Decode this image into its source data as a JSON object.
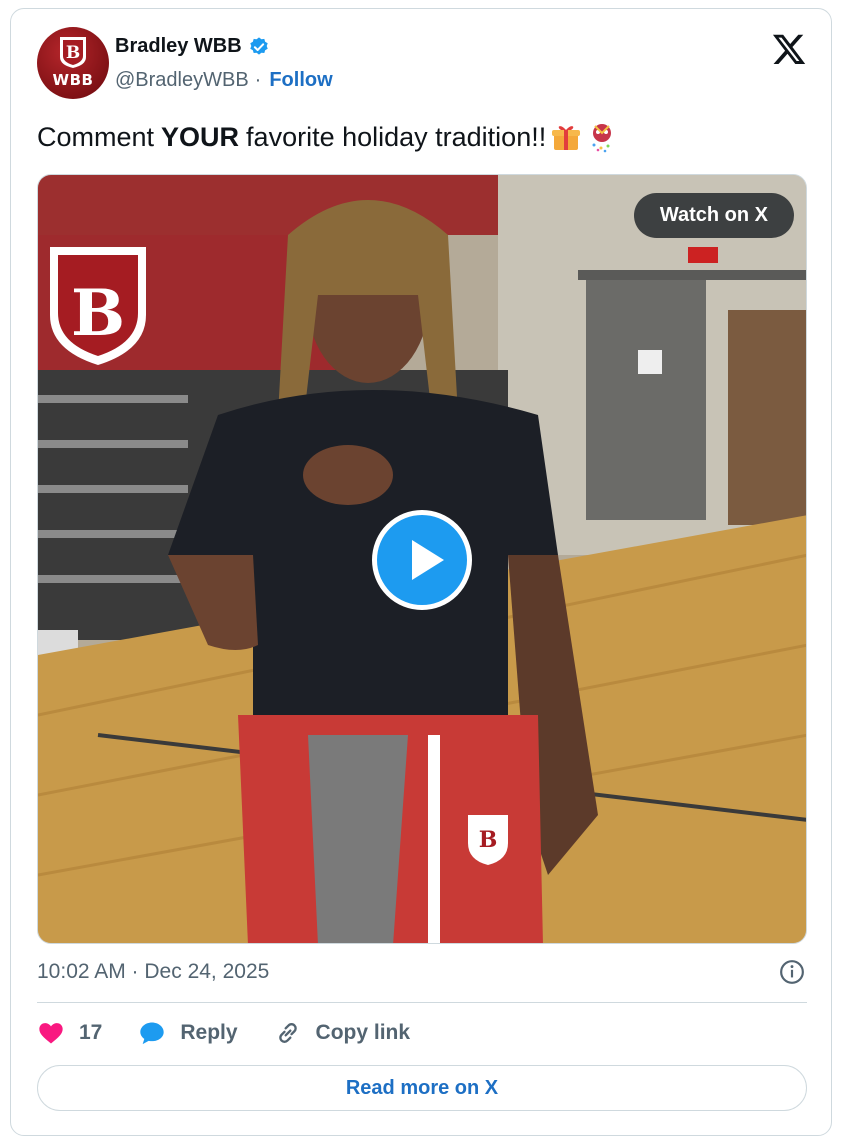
{
  "author": {
    "name": "Bradley WBB",
    "handle": "@BradleyWBB",
    "separator": "·",
    "follow_label": "Follow",
    "avatar_text": "WBB",
    "verified": true
  },
  "tweet": {
    "text_before": "Comment",
    "text_bold": "YOUR",
    "text_after": "favorite holiday tradition!!",
    "emojis": [
      "gift-emoji",
      "party-popper-emoji"
    ]
  },
  "media": {
    "type": "video",
    "watch_label": "Watch on X"
  },
  "meta": {
    "timestamp": "10:02 AM · Dec 24, 2025"
  },
  "actions": {
    "likes_count": "17",
    "reply_label": "Reply",
    "copy_label": "Copy link"
  },
  "footer": {
    "read_more_label": "Read more on X"
  },
  "colors": {
    "accent": "#1d9bf0",
    "link": "#1d6fc4",
    "like": "#f91880",
    "brand_red": "#a51c22"
  }
}
